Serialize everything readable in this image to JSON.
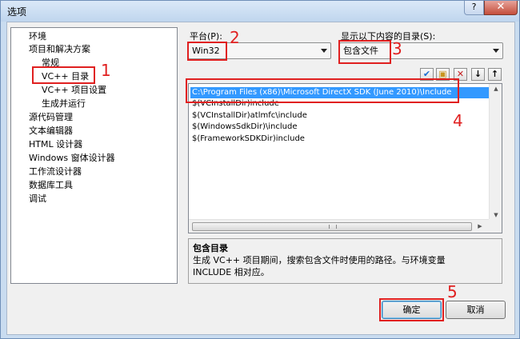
{
  "window": {
    "title": "选项",
    "help": "?",
    "close": "✕"
  },
  "tree": {
    "items": [
      {
        "label": "环境"
      },
      {
        "label": "项目和解决方案"
      },
      {
        "label": "常规"
      },
      {
        "label": "VC++ 目录"
      },
      {
        "label": "VC++ 项目设置"
      },
      {
        "label": "生成并运行"
      },
      {
        "label": "源代码管理"
      },
      {
        "label": "文本编辑器"
      },
      {
        "label": "HTML 设计器"
      },
      {
        "label": "Windows 窗体设计器"
      },
      {
        "label": "工作流设计器"
      },
      {
        "label": "数据库工具"
      },
      {
        "label": "调试"
      }
    ]
  },
  "platform": {
    "label": "平台(P):",
    "value": "Win32"
  },
  "show_dirs": {
    "label": "显示以下内容的目录(S):",
    "value": "包含文件"
  },
  "toolbar": {
    "check": "✔",
    "new_folder": "▣",
    "delete": "✕",
    "down": "↓",
    "up": "↑"
  },
  "directories": [
    "C:\\Program Files (x86)\\Microsoft DirectX SDK (June 2010)\\Include",
    "$(VCInstallDir)include",
    "$(VCInstallDir)atlmfc\\include",
    "$(WindowsSdkDir)\\include",
    "$(FrameworkSDKDir)include"
  ],
  "description": {
    "title": "包含目录",
    "text": "生成 VC++ 项目期间，搜索包含文件时使用的路径。与环境变量 INCLUDE 相对应。"
  },
  "buttons": {
    "ok": "确定",
    "cancel": "取消"
  },
  "annotations": {
    "n1": "1",
    "n2": "2",
    "n3": "3",
    "n4": "4",
    "n5": "5"
  },
  "colors": {
    "annotation": "#e02020",
    "selection": "#3399ff"
  }
}
